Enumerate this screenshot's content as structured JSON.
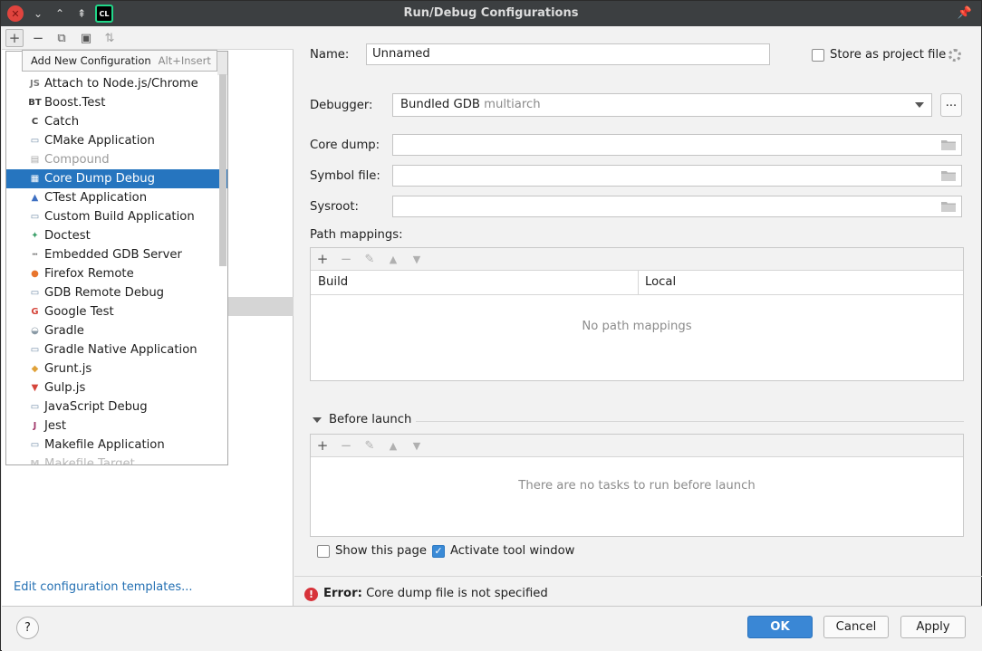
{
  "window": {
    "title": "Run/Debug Configurations",
    "app_logo_text": "CL"
  },
  "left_panel": {
    "tooltip": {
      "label": "Add New Configuration",
      "shortcut": "Alt+Insert"
    },
    "edit_templates_link": "Edit configuration templates...",
    "popup_items": [
      {
        "label": "Attach to Node.js/Chrome",
        "icon": "nodejs-attach-icon",
        "icon_glyph": "JS",
        "icon_color": "#7a7a7a",
        "state": "normal"
      },
      {
        "label": "Boost.Test",
        "icon": "boost-test-icon",
        "icon_glyph": "BT",
        "icon_color": "#3d3d3d",
        "state": "normal"
      },
      {
        "label": "Catch",
        "icon": "catch-icon",
        "icon_glyph": "C",
        "icon_color": "#3d3d3d",
        "state": "normal"
      },
      {
        "label": "CMake Application",
        "icon": "cmake-app-icon",
        "icon_glyph": "▭",
        "icon_color": "#6e8aa6",
        "state": "normal"
      },
      {
        "label": "Compound",
        "icon": "compound-icon",
        "icon_glyph": "▤",
        "icon_color": "#a8a8a8",
        "state": "disabled"
      },
      {
        "label": "Core Dump Debug",
        "icon": "core-dump-icon",
        "icon_glyph": "▦",
        "icon_color": "#e06c5a",
        "state": "selected"
      },
      {
        "label": "CTest Application",
        "icon": "ctest-icon",
        "icon_glyph": "▲",
        "icon_color": "#3d6fc2",
        "state": "normal"
      },
      {
        "label": "Custom Build Application",
        "icon": "custom-build-icon",
        "icon_glyph": "▭",
        "icon_color": "#6e8aa6",
        "state": "normal"
      },
      {
        "label": "Doctest",
        "icon": "doctest-icon",
        "icon_glyph": "✦",
        "icon_color": "#3ca06a",
        "state": "normal"
      },
      {
        "label": "Embedded GDB Server",
        "icon": "embedded-gdb-icon",
        "icon_glyph": "┅",
        "icon_color": "#6a6a6a",
        "state": "normal"
      },
      {
        "label": "Firefox Remote",
        "icon": "firefox-icon",
        "icon_glyph": "●",
        "icon_color": "#e8752e",
        "state": "normal"
      },
      {
        "label": "GDB Remote Debug",
        "icon": "gdb-remote-icon",
        "icon_glyph": "▭",
        "icon_color": "#6e8aa6",
        "state": "normal"
      },
      {
        "label": "Google Test",
        "icon": "google-test-icon",
        "icon_glyph": "G",
        "icon_color": "#d5453a",
        "state": "normal"
      },
      {
        "label": "Gradle",
        "icon": "gradle-icon",
        "icon_glyph": "◒",
        "icon_color": "#8a9aa6",
        "state": "normal"
      },
      {
        "label": "Gradle Native Application",
        "icon": "gradle-native-icon",
        "icon_glyph": "▭",
        "icon_color": "#6e8aa6",
        "state": "normal"
      },
      {
        "label": "Grunt.js",
        "icon": "grunt-icon",
        "icon_glyph": "◆",
        "icon_color": "#e0a23a",
        "state": "normal"
      },
      {
        "label": "Gulp.js",
        "icon": "gulp-icon",
        "icon_glyph": "▼",
        "icon_color": "#d5453a",
        "state": "normal"
      },
      {
        "label": "JavaScript Debug",
        "icon": "js-debug-icon",
        "icon_glyph": "▭",
        "icon_color": "#6e8aa6",
        "state": "normal"
      },
      {
        "label": "Jest",
        "icon": "jest-icon",
        "icon_glyph": "J",
        "icon_color": "#a33c6e",
        "state": "normal"
      },
      {
        "label": "Makefile Application",
        "icon": "makefile-app-icon",
        "icon_glyph": "▭",
        "icon_color": "#6e8aa6",
        "state": "normal"
      },
      {
        "label": "Makefile Target",
        "icon": "makefile-target-icon",
        "icon_glyph": "M",
        "icon_color": "#c8c8c8",
        "state": "faded"
      }
    ]
  },
  "form": {
    "name_label": "Name:",
    "name_value": "Unnamed",
    "store_label": "Store as project file",
    "debugger_label": "Debugger:",
    "debugger_value": "Bundled GDB",
    "debugger_hint": "multiarch",
    "ellipsis": "...",
    "core_dump_label": "Core dump:",
    "symbol_file_label": "Symbol file:",
    "sysroot_label": "Sysroot:",
    "path_mappings_label": "Path mappings:",
    "pm_col_build": "Build",
    "pm_col_local": "Local",
    "pm_empty": "No path mappings",
    "before_launch_label": "Before launch",
    "bl_empty": "There are no tasks to run before launch",
    "show_page_label": "Show this page",
    "activate_tool_label": "Activate tool window",
    "error_bold": "Error:",
    "error_text": "Core dump file is not specified"
  },
  "footer": {
    "help": "?",
    "ok": "OK",
    "cancel": "Cancel",
    "apply": "Apply"
  },
  "colors": {
    "accent": "#2675bf",
    "error": "#d7333a",
    "link": "#2470b3"
  }
}
